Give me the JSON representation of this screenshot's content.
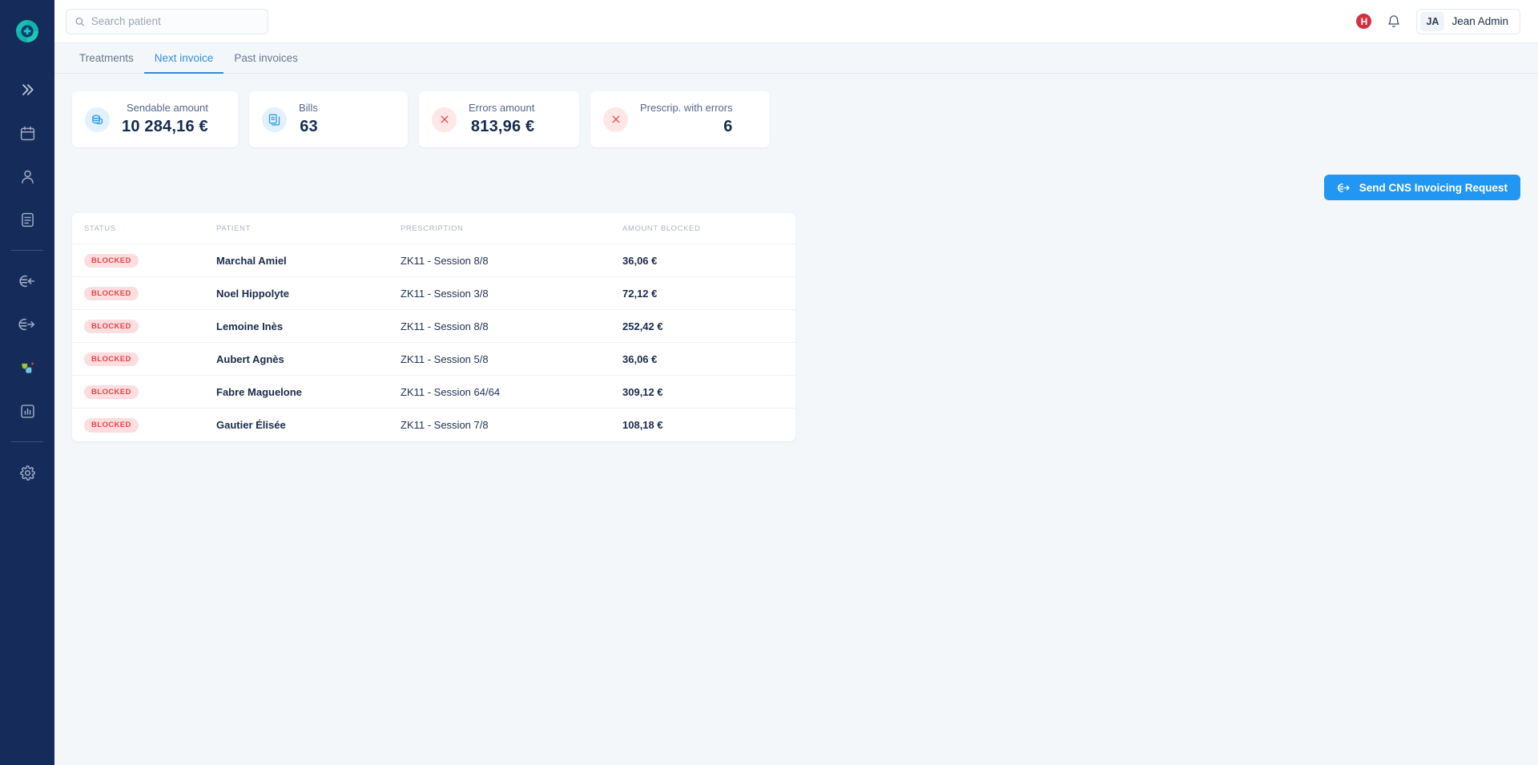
{
  "brand": {
    "logo_icon": "medical-cross-circle-logo",
    "accent": "#2196f3",
    "sidebar_bg": "#152c5b"
  },
  "sidebar": {
    "items": [
      {
        "name": "collapse-expand",
        "icon": "chevron-double-right-icon"
      },
      {
        "name": "calendar",
        "icon": "calendar-icon"
      },
      {
        "name": "patients",
        "icon": "user-icon"
      },
      {
        "name": "documents",
        "icon": "document-lines-icon"
      },
      {
        "name": "incoming-payments",
        "icon": "euro-arrow-left-icon"
      },
      {
        "name": "outgoing-payments",
        "icon": "euro-arrow-right-icon"
      },
      {
        "name": "apps",
        "icon": "colored-shapes-icon"
      },
      {
        "name": "statistics",
        "icon": "bar-chart-icon"
      },
      {
        "name": "settings",
        "icon": "gear-icon"
      }
    ]
  },
  "search": {
    "placeholder": "Search patient",
    "value": "",
    "icon": "search-icon"
  },
  "topbar": {
    "alert_badge": "H",
    "bell_icon": "bell-icon",
    "user_initials": "JA",
    "user_name": "Jean Admin"
  },
  "tabs": [
    {
      "label": "Treatments",
      "active": false
    },
    {
      "label": "Next invoice",
      "active": true
    },
    {
      "label": "Past invoices",
      "active": false
    }
  ],
  "cards": [
    {
      "label": "Sendable amount",
      "value": "10 284,16 €",
      "icon": "coins-icon",
      "tone": "blue"
    },
    {
      "label": "Bills",
      "value": "63",
      "icon": "documents-icon",
      "tone": "blue"
    },
    {
      "label": "Errors amount",
      "value": "813,96 €",
      "icon": "close-x-icon",
      "tone": "red"
    },
    {
      "label": "Prescrip. with errors",
      "value": "6",
      "icon": "close-x-icon",
      "tone": "red"
    }
  ],
  "action": {
    "send_label": "Send CNS Invoicing Request",
    "icon": "euro-arrow-right-icon"
  },
  "table": {
    "columns": [
      "STATUS",
      "PATIENT",
      "PRESCRIPTION",
      "AMOUNT BLOCKED"
    ],
    "rows": [
      {
        "status": "BLOCKED",
        "patient": "Marchal Amiel",
        "prescription": "ZK11 - Session 8/8",
        "amount": "36,06 €"
      },
      {
        "status": "BLOCKED",
        "patient": "Noel Hippolyte",
        "prescription": "ZK11 - Session 3/8",
        "amount": "72,12 €"
      },
      {
        "status": "BLOCKED",
        "patient": "Lemoine Inès",
        "prescription": "ZK11 - Session 8/8",
        "amount": "252,42 €"
      },
      {
        "status": "BLOCKED",
        "patient": "Aubert Agnès",
        "prescription": "ZK11 - Session 5/8",
        "amount": "36,06 €"
      },
      {
        "status": "BLOCKED",
        "patient": "Fabre Maguelone",
        "prescription": "ZK11 - Session 64/64",
        "amount": "309,12 €"
      },
      {
        "status": "BLOCKED",
        "patient": "Gautier Élisée",
        "prescription": "ZK11 - Session 7/8",
        "amount": "108,18 €"
      }
    ]
  }
}
